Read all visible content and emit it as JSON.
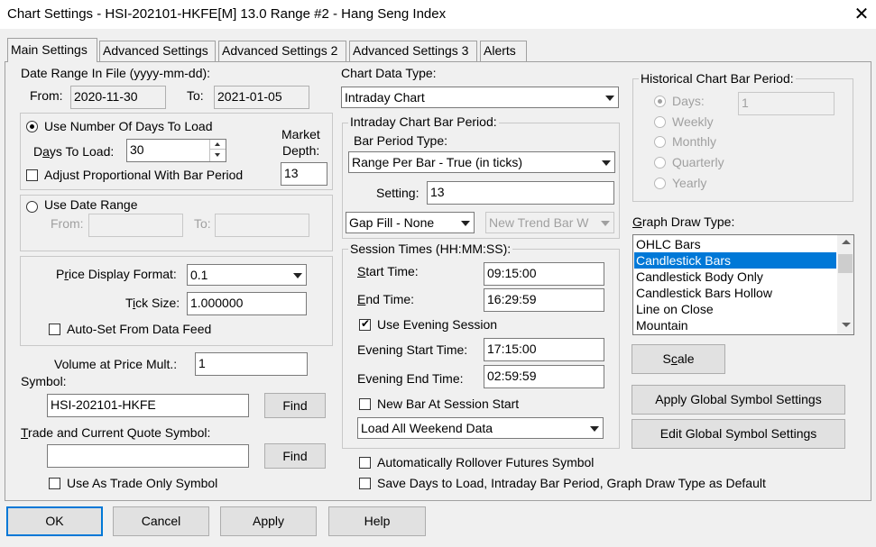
{
  "window": {
    "title": "Chart Settings - HSI-202101-HKFE[M]  13.0 Range  #2 - Hang Seng Index",
    "close_glyph": "✕"
  },
  "tabs": [
    {
      "label": "Main Settings",
      "active": true
    },
    {
      "label": "Advanced Settings",
      "active": false
    },
    {
      "label": "Advanced Settings 2",
      "active": false
    },
    {
      "label": "Advanced Settings 3",
      "active": false
    },
    {
      "label": "Alerts",
      "active": false
    }
  ],
  "date_range": {
    "label": "Date Range In File (yyyy-mm-dd):",
    "from_label": "From:",
    "from_value": "2020-11-30",
    "to_label": "To:",
    "to_value": "2021-01-05"
  },
  "days_group": {
    "radio_label": "Use Number Of Days To Load",
    "days_label_pre": "D",
    "days_label_ul": "a",
    "days_label_post": "ys To Load:",
    "days_value": "30",
    "market_depth_label_1": "Market",
    "market_depth_label_2": "Depth:",
    "market_depth_value": "13",
    "adjust_label": "Adjust Proportional With Bar Period"
  },
  "date_range_group": {
    "radio_label": "Use Date Range",
    "from_label": "From:",
    "to_label": "To:",
    "from_value": "",
    "to_value": ""
  },
  "price_group": {
    "format_label_pre": "P",
    "format_label_ul": "r",
    "format_label_post": "ice Display Format:",
    "format_value": "0.1",
    "tick_label_pre": "T",
    "tick_label_ul": "i",
    "tick_label_post": "ck Size:",
    "tick_value": "1.000000",
    "autoset_label": "Auto-Set From Data Feed"
  },
  "volume": {
    "label": "Volume at Price Mult.:",
    "value": "1"
  },
  "symbol": {
    "label": "Symbol:",
    "value": "HSI-202101-HKFE",
    "find_label": "Find"
  },
  "trade_symbol": {
    "label_pre": "",
    "label_ul": "T",
    "label_post": "rade and Current Quote Symbol:",
    "value": "",
    "find_label": "Find",
    "trade_only_label": "Use As Trade Only Symbol"
  },
  "chart_data_type": {
    "label": "Chart Data Type:",
    "value": "Intraday Chart"
  },
  "intraday_period": {
    "group_label": "Intraday Chart Bar Period:",
    "type_label": "Bar Period Type:",
    "type_value": "Range Per Bar - True (in ticks)",
    "setting_label": "Setting:",
    "setting_value": "13",
    "gap_fill_value": "Gap Fill - None",
    "new_trend_value": "New Trend Bar W"
  },
  "session_times": {
    "group_label": "Session Times (HH:MM:SS):",
    "start_label_ul": "S",
    "start_label_post": "tart Time:",
    "start_value": "09:15:00",
    "end_label_ul": "E",
    "end_label_post": "nd Time:",
    "end_value": "16:29:59",
    "evening_checkbox_label": "Use Evening Session",
    "evening_start_label": "Evening Start Time:",
    "evening_start_value": "17:15:00",
    "evening_end_label": "Evening End Time:",
    "evening_end_value": "02:59:59",
    "new_bar_label": "New Bar At Session Start",
    "weekend_value": "Load All Weekend Data"
  },
  "rollover_label": "Automatically Rollover Futures Symbol",
  "save_defaults_label": "Save Days to Load, Intraday Bar Period, Graph Draw Type as Default",
  "historical_period": {
    "group_label": "Historical Chart Bar Period:",
    "days_label": "Days:",
    "days_value": "1",
    "weekly_label": "Weekly",
    "monthly_label": "Monthly",
    "quarterly_label": "Quarterly",
    "yearly_label": "Yearly"
  },
  "graph_draw": {
    "label_pre": "",
    "label_ul": "G",
    "label_post": "raph Draw Type:",
    "items": [
      "OHLC Bars",
      "Candlestick Bars",
      "Candlestick Body Only",
      "Candlestick Bars Hollow",
      "Line on Close",
      "Mountain"
    ],
    "selected_index": 1
  },
  "scale_button_pre": "S",
  "scale_button_ul": "c",
  "scale_button_post": "ale",
  "apply_global_label": "Apply Global Symbol Settings",
  "edit_global_label": "Edit Global Symbol Settings",
  "footer": {
    "ok_label": "OK",
    "cancel_label": "Cancel",
    "apply_label": "Apply",
    "help_label": "Help"
  },
  "colors": {
    "accent": "#0078d7",
    "disabled_text": "#a0a0a0",
    "background": "#f0f0f0"
  }
}
